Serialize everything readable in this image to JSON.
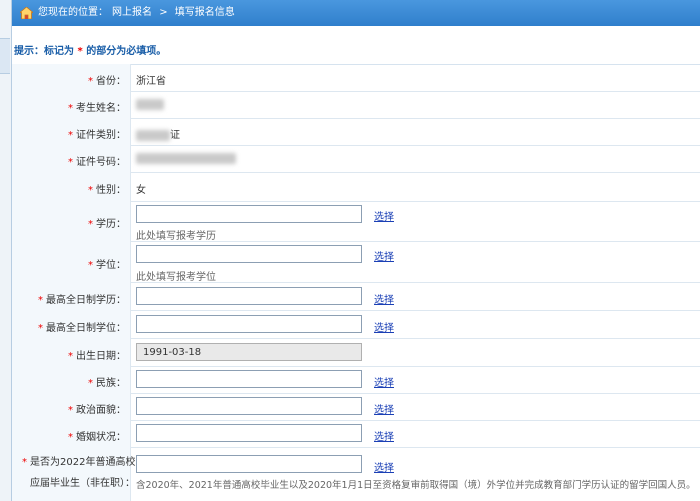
{
  "breadcrumb": {
    "prefix": "您现在的位置：",
    "level1": "网上报名",
    "sep": ">",
    "level2": "填写报名信息"
  },
  "hint": {
    "before": "提示：标记为",
    "star": "*",
    "after": "的部分为必填项。"
  },
  "required_mark": "*",
  "select_label": "选择",
  "fields": {
    "province": {
      "label": "省份：",
      "value": "浙江省"
    },
    "name": {
      "label": "考生姓名："
    },
    "id_type": {
      "label": "证件类别：",
      "value_suffix": "证"
    },
    "id_number": {
      "label": "证件号码："
    },
    "gender": {
      "label": "性别：",
      "value": "女"
    },
    "education": {
      "label": "学历：",
      "value": "",
      "sub": "此处填写报考学历"
    },
    "degree": {
      "label": "学位：",
      "value": "",
      "sub": "此处填写报考学位"
    },
    "highest_edu": {
      "label": "最高全日制学历：",
      "value": ""
    },
    "highest_degree": {
      "label": "最高全日制学位：",
      "value": ""
    },
    "birth_date": {
      "label": "出生日期：",
      "value": "1991-03-18"
    },
    "ethnicity": {
      "label": "民族：",
      "value": ""
    },
    "political": {
      "label": "政治面貌：",
      "value": ""
    },
    "marital": {
      "label": "婚姻状况：",
      "value": ""
    },
    "graduate_2022": {
      "label_line1": "是否为2022年普通高校",
      "label_line2": "应届毕业生（非在职）：",
      "value": "",
      "note": "含2020年、2021年普通高校毕业生以及2020年1月1日至资格复审前取得国（境）外学位并完成教育部门学历认证的留学回国人员。"
    }
  },
  "colors": {
    "header_blue": "#3a8ad6",
    "label_bg": "#f3f8fc",
    "required_red": "#ee0000",
    "link_blue": "#1a3fb5"
  }
}
